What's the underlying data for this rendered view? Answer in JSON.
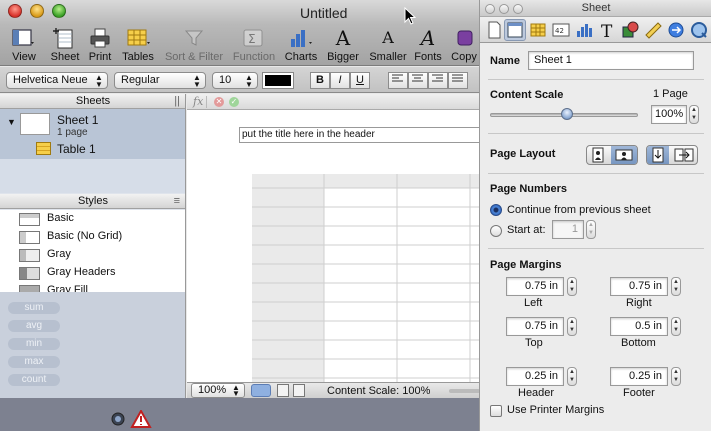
{
  "window": {
    "title": "Untitled"
  },
  "toolbar": {
    "view": "View",
    "sheet": "Sheet",
    "print": "Print",
    "tables": "Tables",
    "sort_filter": "Sort & Filter",
    "function": "Function",
    "charts": "Charts",
    "bigger": "Bigger",
    "smaller": "Smaller",
    "fonts": "Fonts",
    "copy": "Copy"
  },
  "format_bar": {
    "font_family": "Helvetica Neue",
    "font_style": "Regular",
    "font_size": "10",
    "bold": "B",
    "italic": "I",
    "underline": "U"
  },
  "sidebar": {
    "sheets_header": "Sheets",
    "sheet_name": "Sheet 1",
    "sheet_pages": "1 page",
    "table_name": "Table 1",
    "styles_header": "Styles",
    "styles": [
      {
        "label": "Basic"
      },
      {
        "label": "Basic (No Grid)"
      },
      {
        "label": "Gray"
      },
      {
        "label": "Gray Headers"
      },
      {
        "label": "Gray Fill"
      }
    ],
    "functions": [
      "sum",
      "avg",
      "min",
      "max",
      "count"
    ]
  },
  "canvas": {
    "fx_label": "fx",
    "header_text": "put the title here in the header"
  },
  "status": {
    "zoom": "100%",
    "content_scale": "Content Scale: 100%"
  },
  "inspector": {
    "title": "Sheet",
    "name_label": "Name",
    "name_value": "Sheet 1",
    "content_scale_label": "Content Scale",
    "pages_text": "1 Page",
    "scale_value": "100%",
    "scale_fraction": 0.52,
    "page_layout_label": "Page Layout",
    "page_numbers_label": "Page Numbers",
    "continue_label": "Continue from previous sheet",
    "start_at_label": "Start at:",
    "start_at_value": "1",
    "page_margins_label": "Page Margins",
    "margin_left": "0.75 in",
    "margin_left_label": "Left",
    "margin_right": "0.75 in",
    "margin_right_label": "Right",
    "margin_top": "0.75 in",
    "margin_top_label": "Top",
    "margin_bottom": "0.5 in",
    "margin_bottom_label": "Bottom",
    "margin_header": "0.25 in",
    "margin_header_label": "Header",
    "margin_footer": "0.25 in",
    "margin_footer_label": "Footer",
    "printer_margins_label": "Use Printer Margins"
  }
}
